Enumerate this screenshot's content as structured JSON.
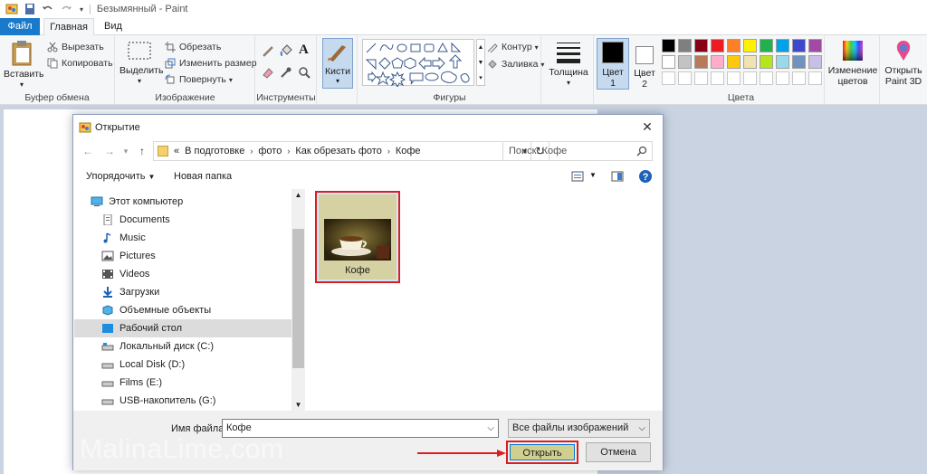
{
  "window": {
    "title": "Безымянный - Paint"
  },
  "tabs": [
    "Файл",
    "Главная",
    "Вид"
  ],
  "ribbon": {
    "clipboard": {
      "paste": "Вставить",
      "cut": "Вырезать",
      "copy": "Копировать",
      "label": "Буфер обмена"
    },
    "image": {
      "select": "Выделить",
      "crop": "Обрезать",
      "resize": "Изменить размер",
      "rotate": "Повернуть",
      "label": "Изображение"
    },
    "tools": {
      "label": "Инструменты",
      "text_icon": "A"
    },
    "brushes": {
      "label": "Кисти"
    },
    "shapes": {
      "outline": "Контур",
      "fill": "Заливка",
      "label": "Фигуры"
    },
    "size": {
      "label": "Толщина"
    },
    "color1": {
      "line1": "Цвет",
      "line2": "1",
      "value": "#000000"
    },
    "color2": {
      "line1": "Цвет",
      "line2": "2",
      "value": "#ffffff"
    },
    "colors": {
      "label": "Цвета",
      "palette_row1": [
        "#000000",
        "#7f7f7f",
        "#880015",
        "#ed1c24",
        "#ff7f27",
        "#fff200",
        "#22b14c",
        "#00a2e8",
        "#3f48cc",
        "#a349a4"
      ],
      "palette_row2": [
        "#ffffff",
        "#c3c3c3",
        "#b97a57",
        "#ffaec9",
        "#ffc90e",
        "#efe4b0",
        "#b5e61d",
        "#99d9ea",
        "#7092be",
        "#c8bfe7"
      ]
    },
    "edit_colors": {
      "line1": "Изменение",
      "line2": "цветов"
    },
    "paint3d": {
      "line1": "Открыть",
      "line2": "Paint 3D"
    }
  },
  "dialog": {
    "title": "Открытие",
    "path": [
      "«",
      "В подготовке",
      "фото",
      "Как обрезать фото",
      "Кофе"
    ],
    "search_placeholder": "Поиск: Кофе",
    "organize": "Упорядочить",
    "new_folder": "Новая папка",
    "tree": [
      "Этот компьютер",
      "Documents",
      "Music",
      "Pictures",
      "Videos",
      "Загрузки",
      "Объемные объекты",
      "Рабочий стол",
      "Локальный диск (C:)",
      "Local Disk (D:)",
      "Films (E:)",
      "USB-накопитель (G:)"
    ],
    "selected_tree_item": "Рабочий стол",
    "file_item": "Кофе",
    "filename_label": "Имя файла:",
    "filename_value": "Кофе",
    "file_type": "Все файлы изображений",
    "open": "Открыть",
    "cancel": "Отмена"
  },
  "watermark": "MalinaLime.com"
}
